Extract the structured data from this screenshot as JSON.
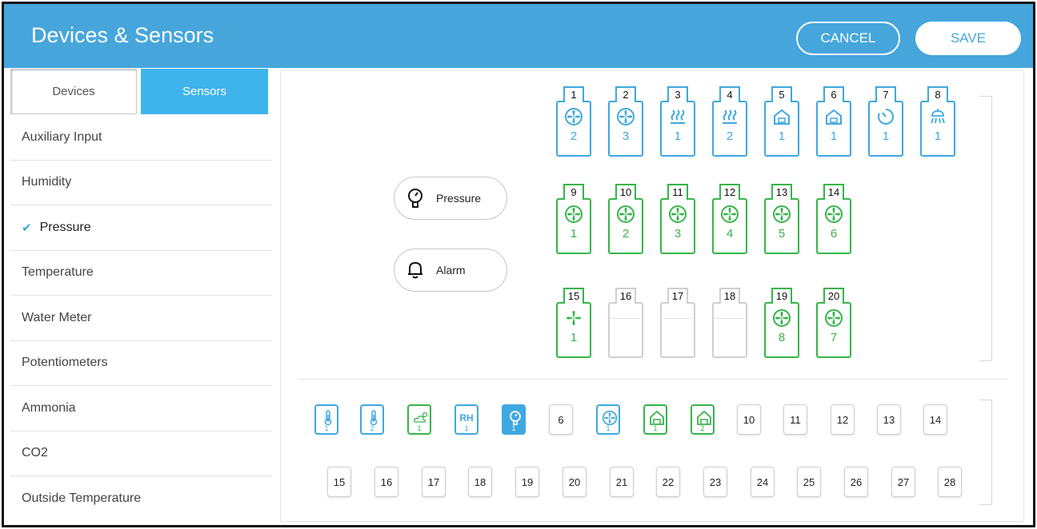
{
  "header": {
    "title": "Devices & Sensors",
    "cancel_label": "CANCEL",
    "save_label": "SAVE"
  },
  "colors": {
    "header_bg": "#46a6db",
    "active_tab": "#3fb4ec",
    "blue": "#3ea8e0",
    "green": "#36b54a",
    "gray": "#cfcfcf"
  },
  "tabs": {
    "devices": "Devices",
    "sensors": "Sensors",
    "active": "Sensors"
  },
  "sidebar": {
    "items": [
      {
        "label": "Auxiliary Input"
      },
      {
        "label": "Humidity"
      },
      {
        "label": "Pressure",
        "check": "✔",
        "selected": true
      },
      {
        "label": "Temperature"
      },
      {
        "label": "Water Meter"
      },
      {
        "label": "Potentiometers"
      },
      {
        "label": "Ammonia"
      },
      {
        "label": "CO2"
      },
      {
        "label": "Outside Temperature"
      }
    ]
  },
  "buttons": {
    "pressure": "Pressure",
    "alarm": "Alarm"
  },
  "devices": [
    {
      "id": "1",
      "color": "blue",
      "icon": "fan-icon",
      "value": "2"
    },
    {
      "id": "2",
      "color": "blue",
      "icon": "fan-icon",
      "value": "3"
    },
    {
      "id": "3",
      "color": "blue",
      "icon": "heater-icon",
      "value": "1"
    },
    {
      "id": "4",
      "color": "blue",
      "icon": "heater-icon",
      "value": "2"
    },
    {
      "id": "5",
      "color": "blue",
      "icon": "curtain-icon",
      "value": "1"
    },
    {
      "id": "6",
      "color": "blue",
      "icon": "curtain-icon",
      "value": "1"
    },
    {
      "id": "7",
      "color": "blue",
      "icon": "timer-icon",
      "value": "1"
    },
    {
      "id": "8",
      "color": "blue",
      "icon": "sprinkler-icon",
      "value": "1"
    },
    {
      "id": "9",
      "color": "green",
      "icon": "fan-icon",
      "value": "1"
    },
    {
      "id": "10",
      "color": "green",
      "icon": "fan-icon",
      "value": "2"
    },
    {
      "id": "11",
      "color": "green",
      "icon": "fan-icon",
      "value": "3"
    },
    {
      "id": "12",
      "color": "green",
      "icon": "fan-icon",
      "value": "4"
    },
    {
      "id": "13",
      "color": "green",
      "icon": "fan-icon",
      "value": "5"
    },
    {
      "id": "14",
      "color": "green",
      "icon": "fan-icon",
      "value": "6"
    },
    {
      "id": "15",
      "color": "green",
      "icon": "stir-fan-icon",
      "value": "1"
    },
    {
      "id": "16",
      "color": "gray",
      "icon": "",
      "value": ""
    },
    {
      "id": "17",
      "color": "gray",
      "icon": "",
      "value": ""
    },
    {
      "id": "18",
      "color": "gray",
      "icon": "",
      "value": ""
    },
    {
      "id": "19",
      "color": "green",
      "icon": "fan-icon",
      "value": "8"
    },
    {
      "id": "20",
      "color": "green",
      "icon": "fan-icon",
      "value": "7"
    }
  ],
  "sensors": [
    {
      "label": "",
      "sub": "1",
      "style": "blue",
      "icon": "thermometer-icon"
    },
    {
      "label": "",
      "sub": "2",
      "style": "blue",
      "icon": "thermometer-icon"
    },
    {
      "label": "",
      "sub": "1",
      "style": "green",
      "icon": "outside-weather-icon"
    },
    {
      "label": "RH",
      "sub": "1",
      "style": "blue",
      "icon": ""
    },
    {
      "label": "",
      "sub": "1",
      "style": "filled",
      "icon": "pressure-icon"
    },
    {
      "label": "6",
      "sub": "",
      "style": "gray",
      "icon": ""
    },
    {
      "label": "",
      "sub": "1",
      "style": "blue",
      "icon": "fan-icon"
    },
    {
      "label": "",
      "sub": "1",
      "style": "green",
      "icon": "house-icon"
    },
    {
      "label": "",
      "sub": "2",
      "style": "green",
      "icon": "house-icon"
    },
    {
      "label": "10",
      "sub": "",
      "style": "gray",
      "icon": ""
    },
    {
      "label": "11",
      "sub": "",
      "style": "gray",
      "icon": ""
    },
    {
      "label": "12",
      "sub": "",
      "style": "gray",
      "icon": ""
    },
    {
      "label": "13",
      "sub": "",
      "style": "gray",
      "icon": ""
    },
    {
      "label": "14",
      "sub": "",
      "style": "gray",
      "icon": ""
    },
    {
      "label": "15",
      "sub": "",
      "style": "gray",
      "icon": ""
    },
    {
      "label": "16",
      "sub": "",
      "style": "gray",
      "icon": ""
    },
    {
      "label": "17",
      "sub": "",
      "style": "gray",
      "icon": ""
    },
    {
      "label": "18",
      "sub": "",
      "style": "gray",
      "icon": ""
    },
    {
      "label": "19",
      "sub": "",
      "style": "gray",
      "icon": ""
    },
    {
      "label": "20",
      "sub": "",
      "style": "gray",
      "icon": ""
    },
    {
      "label": "21",
      "sub": "",
      "style": "gray",
      "icon": ""
    },
    {
      "label": "22",
      "sub": "",
      "style": "gray",
      "icon": ""
    },
    {
      "label": "23",
      "sub": "",
      "style": "gray",
      "icon": ""
    },
    {
      "label": "24",
      "sub": "",
      "style": "gray",
      "icon": ""
    },
    {
      "label": "25",
      "sub": "",
      "style": "gray",
      "icon": ""
    },
    {
      "label": "26",
      "sub": "",
      "style": "gray",
      "icon": ""
    },
    {
      "label": "27",
      "sub": "",
      "style": "gray",
      "icon": ""
    },
    {
      "label": "28",
      "sub": "",
      "style": "gray",
      "icon": ""
    }
  ]
}
